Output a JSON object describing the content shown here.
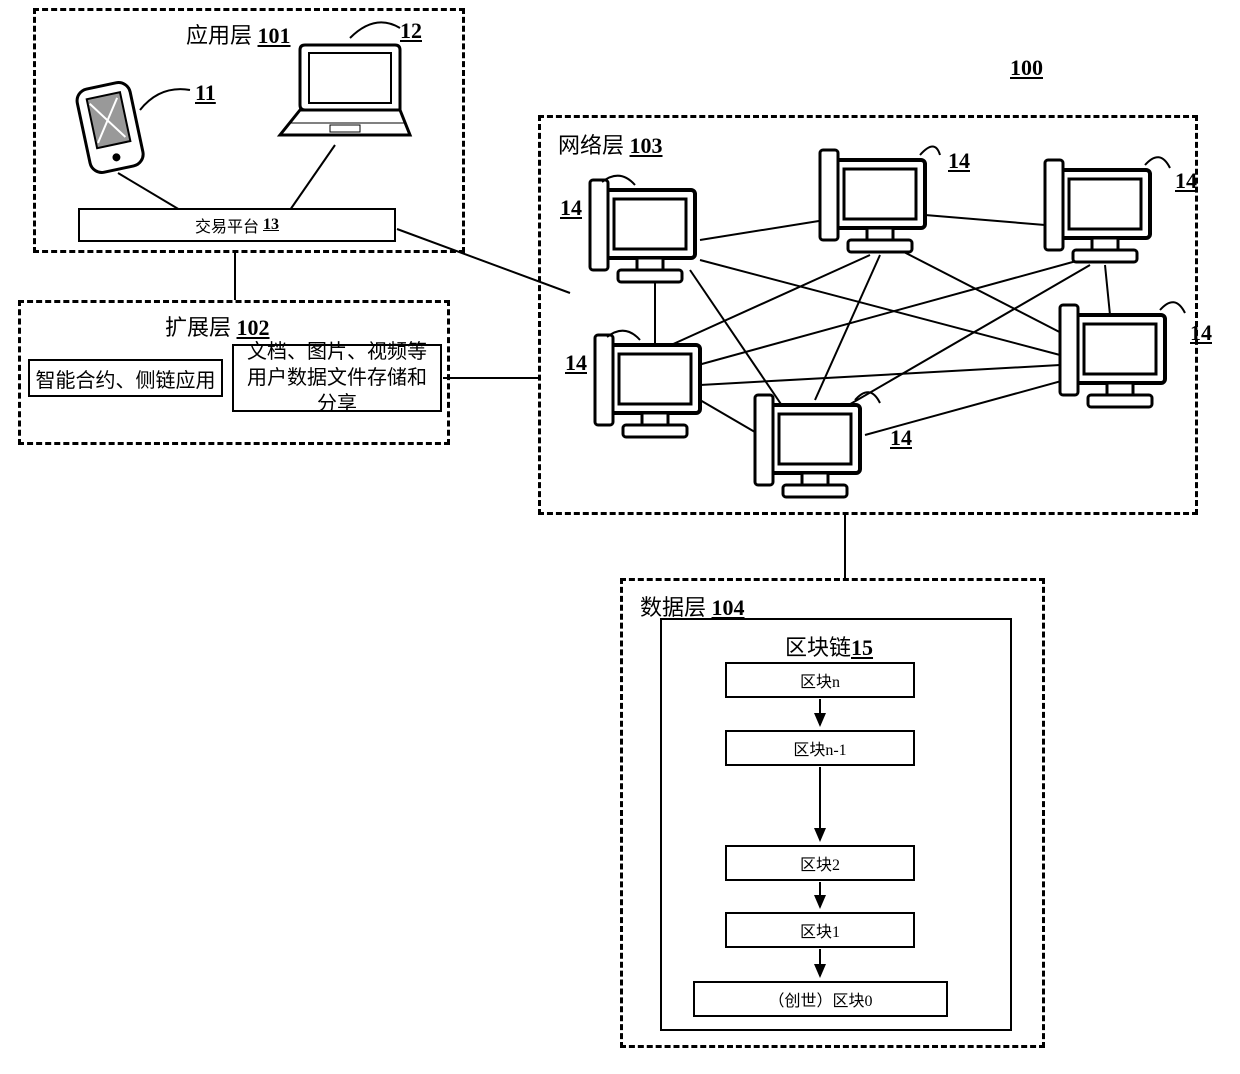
{
  "diagram_ref": "100",
  "app_layer": {
    "title": "应用层",
    "ref": "101",
    "device_phone_ref": "11",
    "device_laptop_ref": "12",
    "platform_label": "交易平台",
    "platform_ref": "13"
  },
  "ext_layer": {
    "title": "扩展层",
    "ref": "102",
    "box1": "智能合约、侧链应用",
    "box2": "文档、图片、视频等用户数据文件存储和分享"
  },
  "net_layer": {
    "title": "网络层",
    "ref": "103",
    "node_ref": "14"
  },
  "data_layer": {
    "title": "数据层",
    "ref": "104",
    "chain_title": "区块链",
    "chain_ref": "15",
    "blocks": [
      "区块n",
      "区块n-1",
      "区块2",
      "区块1",
      "（创世）区块0"
    ]
  }
}
